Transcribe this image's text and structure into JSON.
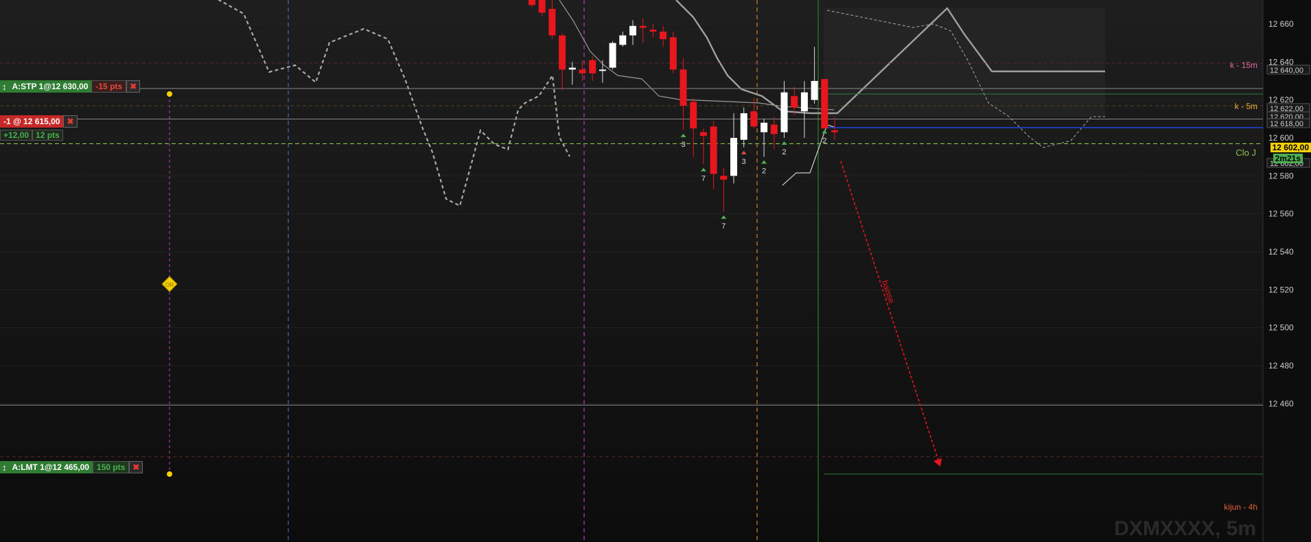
{
  "instrument": "DXMXXXX, 5m",
  "colors": {
    "bull": "#ffffff",
    "bear": "#e8161d",
    "accent_yellow": "#f5d000",
    "pnl_green": "#4caf50"
  },
  "orders": {
    "stop": {
      "label": "A:STP 1@12 630,00",
      "pts": "-15 pts",
      "price": 12630
    },
    "position": {
      "label": "-1 @ 12 615,00",
      "pnl": "+12,00",
      "pts": "12 pts",
      "price": 12615
    },
    "limit": {
      "label": "A:LMT 1@12 465,00",
      "pts": "150 pts",
      "price": 12465
    }
  },
  "levels": {
    "k15m": {
      "label": "k - 15m",
      "price": 12640
    },
    "k5m": {
      "label": "k - 5m",
      "price": 12622
    },
    "cloj": {
      "label": "Clo J",
      "price": 12602
    },
    "kijun4h": {
      "label": "kijun - 4h",
      "price": 12445
    }
  },
  "right_axis": {
    "current_price": "12 602,00",
    "timer": "2m21s",
    "tags": [
      "12 640,00",
      "12 622,00",
      "12 620,00",
      "12 618,00",
      "12 602,00"
    ]
  },
  "annotations": {
    "trend_label": "baisse",
    "diamond_label": "OR"
  },
  "chart_data": {
    "type": "candlestick",
    "y_ticks": [
      "12 660",
      "12 640",
      "12 620",
      "12 600",
      "12 580",
      "12 560",
      "12 540",
      "12 520",
      "12 500",
      "12 480",
      "12 460"
    ],
    "y_tick_values": [
      12660,
      12640,
      12620,
      12600,
      12580,
      12560,
      12540,
      12520,
      12500,
      12480,
      12460
    ],
    "ylim": [
      12438,
      12671
    ],
    "candles": [
      {
        "o": 12676,
        "h": 12680,
        "l": 12669,
        "c": 12670
      },
      {
        "o": 12675,
        "h": 12682,
        "l": 12664,
        "c": 12666
      },
      {
        "o": 12668,
        "h": 12676,
        "l": 12652,
        "c": 12654
      },
      {
        "o": 12654,
        "h": 12655,
        "l": 12625,
        "c": 12636
      },
      {
        "o": 12636,
        "h": 12640,
        "l": 12628,
        "c": 12637
      },
      {
        "o": 12636,
        "h": 12641,
        "l": 12630,
        "c": 12634
      },
      {
        "o": 12641,
        "h": 12643,
        "l": 12630,
        "c": 12634
      },
      {
        "o": 12636,
        "h": 12641,
        "l": 12629,
        "c": 12636
      },
      {
        "o": 12637,
        "h": 12651,
        "l": 12636,
        "c": 12650
      },
      {
        "o": 12649,
        "h": 12656,
        "l": 12648,
        "c": 12654
      },
      {
        "o": 12654,
        "h": 12662,
        "l": 12649,
        "c": 12659
      },
      {
        "o": 12659,
        "h": 12663,
        "l": 12650,
        "c": 12658
      },
      {
        "o": 12657,
        "h": 12660,
        "l": 12653,
        "c": 12656
      },
      {
        "o": 12656,
        "h": 12659,
        "l": 12648,
        "c": 12652
      },
      {
        "o": 12653,
        "h": 12656,
        "l": 12634,
        "c": 12636
      },
      {
        "o": 12636,
        "h": 12642,
        "l": 12604,
        "c": 12617
      },
      {
        "o": 12619,
        "h": 12621,
        "l": 12590,
        "c": 12605
      },
      {
        "o": 12603,
        "h": 12605,
        "l": 12586,
        "c": 12601
      },
      {
        "o": 12606,
        "h": 12609,
        "l": 12573,
        "c": 12581
      },
      {
        "o": 12580,
        "h": 12584,
        "l": 12561,
        "c": 12578
      },
      {
        "o": 12580,
        "h": 12613,
        "l": 12576,
        "c": 12600
      },
      {
        "o": 12599,
        "h": 12616,
        "l": 12595,
        "c": 12613
      },
      {
        "o": 12614,
        "h": 12621,
        "l": 12605,
        "c": 12606
      },
      {
        "o": 12603,
        "h": 12610,
        "l": 12590,
        "c": 12608
      },
      {
        "o": 12607,
        "h": 12611,
        "l": 12594,
        "c": 12602
      },
      {
        "o": 12603,
        "h": 12630,
        "l": 12600,
        "c": 12624
      },
      {
        "o": 12622,
        "h": 12627,
        "l": 12612,
        "c": 12616
      },
      {
        "o": 12614,
        "h": 12630,
        "l": 12600,
        "c": 12624
      },
      {
        "o": 12620,
        "h": 12648,
        "l": 12618,
        "c": 12630
      },
      {
        "o": 12631,
        "h": 12631,
        "l": 12606,
        "c": 12605
      },
      {
        "o": 12604,
        "h": 12611,
        "l": 12599,
        "c": 12603
      }
    ],
    "signals": [
      {
        "candle": 15,
        "label": "3",
        "dir": "up"
      },
      {
        "candle": 17,
        "label": "7",
        "dir": "up"
      },
      {
        "candle": 19,
        "label": "7",
        "dir": "up"
      },
      {
        "candle": 21,
        "label": "3",
        "dir": "down"
      },
      {
        "candle": 23,
        "label": "2",
        "dir": "up"
      },
      {
        "candle": 25,
        "label": "2",
        "dir": "up"
      },
      {
        "candle": 29,
        "label": "2",
        "dir": "up"
      }
    ]
  }
}
